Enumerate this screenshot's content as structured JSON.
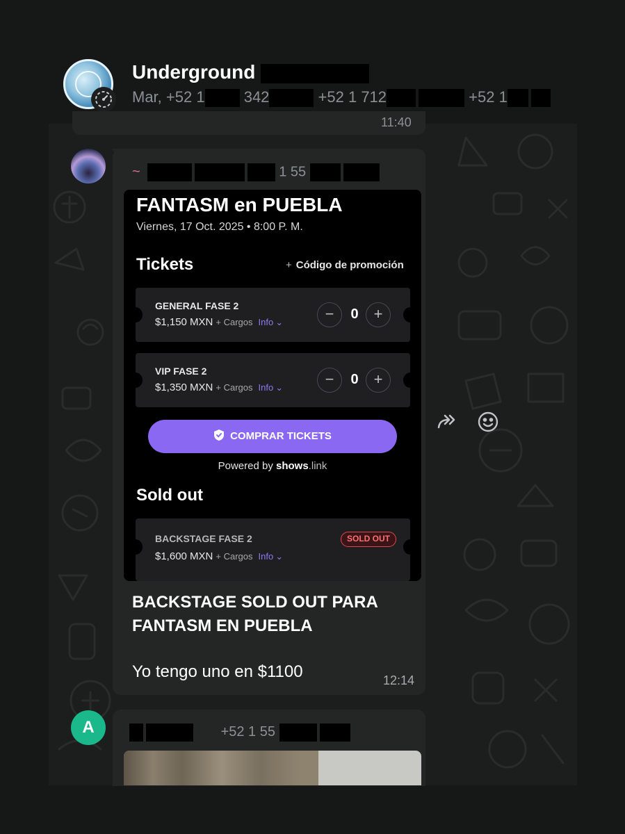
{
  "header": {
    "title": "Underground",
    "subtitle_parts": [
      "Mar, +52 1",
      "342",
      "+52 1 712",
      "+52 1"
    ]
  },
  "previous_message": {
    "time": "11:40"
  },
  "message": {
    "sender_tilde": "~",
    "sender_number_fragment": "1 55",
    "embedded_screenshot": {
      "event_title": "FANTASM en PUEBLA",
      "event_date": "Viernes, 17 Oct. 2025 • 8:00 P. M.",
      "tickets_heading": "Tickets",
      "promo_label": "Código de promoción",
      "tickets": [
        {
          "name": "GENERAL FASE 2",
          "price": "$1,150 MXN",
          "cargos": "+ Cargos",
          "info": "Info",
          "quantity": "0"
        },
        {
          "name": "VIP FASE 2",
          "price": "$1,350 MXN",
          "cargos": "+ Cargos",
          "info": "Info",
          "quantity": "0"
        }
      ],
      "buy_button": "COMPRAR TICKETS",
      "powered_prefix": "Powered by",
      "powered_brand": "shows",
      "powered_suffix": ".link",
      "soldout_heading": "Sold out",
      "soldout_ticket": {
        "name": "BACKSTAGE FASE 2",
        "price": "$1,600 MXN",
        "cargos": "+ Cargos",
        "info": "Info",
        "badge": "SOLD OUT"
      },
      "accent_color": "#8b68f2"
    },
    "caption": "BACKSTAGE SOLD OUT PARA FANTASM EN PUEBLA",
    "text": "Yo tengo uno en $1100",
    "time": "12:14"
  },
  "actions": {
    "forward_icon": "forward-icon",
    "emoji_icon": "emoji-reaction-icon"
  },
  "next_message": {
    "avatar_letter": "A",
    "sender_number_fragment": "+52 1 55"
  }
}
